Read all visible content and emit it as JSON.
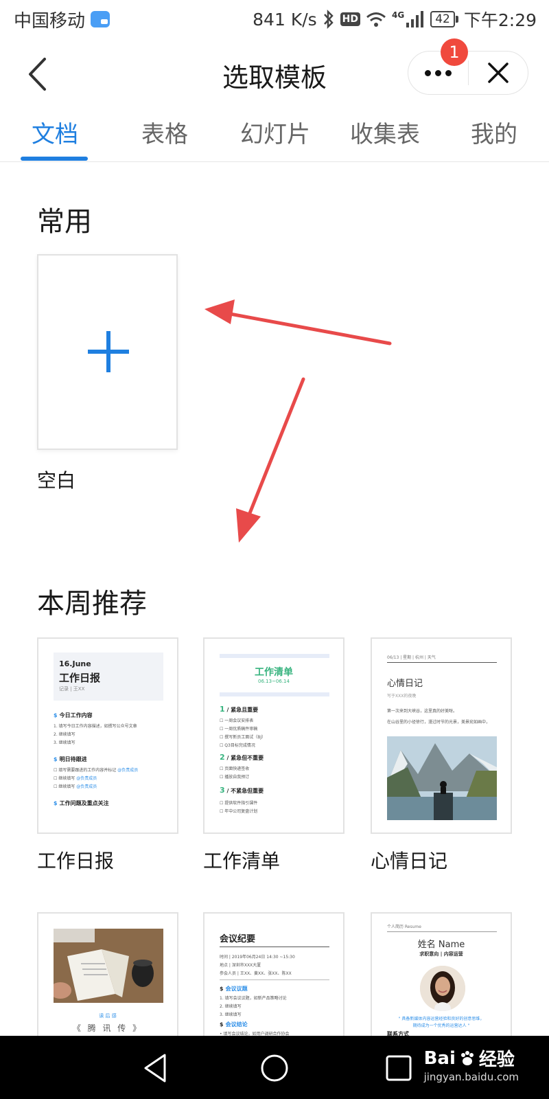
{
  "status_bar": {
    "carrier": "中国移动",
    "speed": "841 K/s",
    "hd": "HD",
    "network": "4G",
    "battery": "42",
    "time": "下午2:29"
  },
  "header": {
    "title": "选取模板",
    "notification_count": "1"
  },
  "tabs": [
    {
      "label": "文档",
      "active": true
    },
    {
      "label": "表格",
      "active": false
    },
    {
      "label": "幻灯片",
      "active": false
    },
    {
      "label": "收集表",
      "active": false
    },
    {
      "label": "我的",
      "active": false
    }
  ],
  "common": {
    "title": "常用",
    "blank_label": "空白"
  },
  "weekly": {
    "title": "本周推荐",
    "templates": [
      {
        "label": "工作日报"
      },
      {
        "label": "工作清单"
      },
      {
        "label": "心情日记"
      },
      {
        "label": ""
      },
      {
        "label": ""
      },
      {
        "label": ""
      }
    ]
  },
  "thumbs": {
    "daily": {
      "date": "16.June",
      "name": "工作日报",
      "recorder": "记录 | 王XX",
      "sec1": "今日工作内容",
      "sec1_lines": [
        "1.  填写今日工作内容描述，如撰写公众号文章",
        "2.  继续填写",
        "3.  继续填写"
      ],
      "sec2": "明日待跟进",
      "sec2_lines": [
        "☐  填写需要跟进的工作内容并标记",
        "☐  继续填写",
        "☐  继续填写"
      ],
      "sec2_tag": "@负责成员",
      "sec3": "工作问题及重点关注"
    },
    "list": {
      "title": "工作清单",
      "date": "06.13~06.14",
      "s1_num": "1",
      "s1": "紧急且重要",
      "s1_lines": [
        "☐  一周会议安排表",
        "☐  一周优质稿件审稿",
        "☐  撰写新员工面试（BJ）",
        "☐  Q3目标完成情况"
      ],
      "s2_num": "2",
      "s2": "紧急但不重要",
      "s2_lines": [
        "☐  页面快递签收",
        "☐  播放自我预订"
      ],
      "s3_num": "3",
      "s3": "不紧急但重要",
      "s3_lines": [
        "☐  提供软件指引课件",
        "☐  年中公司复盘计划"
      ]
    },
    "diary": {
      "meta": "06/13 | 星期 | 杭州 | 天气",
      "title": "心情日记",
      "subtitle": "写于XXX的夜晚",
      "p1": "第一次来到大峡谷，这里真的好美呀。",
      "p2": "在山谷里的小径徐行，漫过时节的光景，美景宛如画中，"
    },
    "book": {
      "small": "读 后 感",
      "title": "《 腾 讯 传 》"
    },
    "meeting": {
      "title": "会议纪要",
      "line1": "时间 | 2019年06月24日  14:30 ~15:30",
      "line2": "地点 | 深圳市XXX大厦",
      "line3": "参会人员 | 王XX、黄XX、张XX、陈XX",
      "sec1": "会议议题",
      "sec1_lines": [
        "1.  填写会议议题，如新产品策略讨论",
        "2.  继续填写",
        "3.  继续填写"
      ],
      "sec2": "会议结论",
      "sec2_lines": [
        "•  填写会议结论，如用户调研合作协会"
      ]
    },
    "resume": {
      "head": "个人简历 Resume",
      "name": "姓名 Name",
      "intent": "求职意向 | 内容运营",
      "quote": "\" 具备新媒体内容运营经验和良好的创意思维，",
      "quote2": "期待成为一个优秀的运营达人 \"",
      "contact": "联系方式"
    }
  },
  "colors": {
    "accent": "#1f7fe0",
    "badge": "#f0493d",
    "arrow": "#e84a4a",
    "list_green": "#36b37e"
  },
  "watermark": {
    "brand": "Bai",
    "brand2": "经验",
    "sub": "jingyan.baidu.com"
  }
}
